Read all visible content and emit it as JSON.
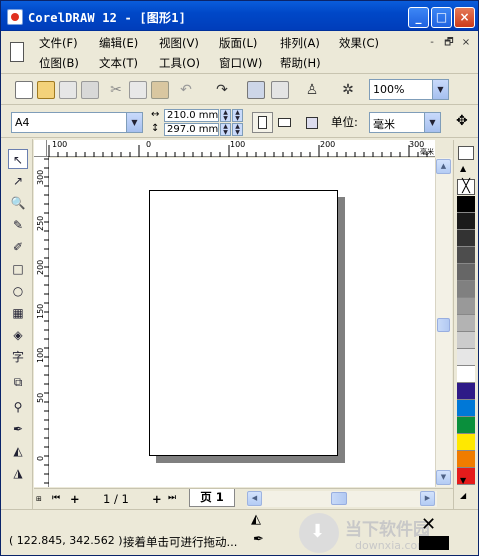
{
  "window": {
    "title": "CorelDRAW 12 - [图形1]",
    "min": "_",
    "max": "□",
    "close": "×"
  },
  "menu": {
    "row1": [
      "文件(F)",
      "编辑(E)",
      "视图(V)",
      "版面(L)",
      "排列(A)",
      "效果(C)"
    ],
    "row2": [
      "位图(B)",
      "文本(T)",
      "工具(O)",
      "窗口(W)",
      "帮助(H)"
    ],
    "mdi": [
      "-",
      "🗗",
      "×"
    ]
  },
  "standard_toolbar": {
    "icons": [
      "new-icon",
      "open-icon",
      "save-icon",
      "print-icon",
      "cut-icon",
      "copy-icon",
      "paste-icon",
      "undo-icon",
      "redo-icon",
      "import-icon",
      "export-icon",
      "app-launcher-icon",
      "corel-online-icon"
    ],
    "zoom_value": "100%"
  },
  "property_bar": {
    "page_size": "A4",
    "width": "210.0 mm",
    "height": "297.0 mm",
    "units_label": "单位:",
    "units_value": "毫米"
  },
  "toolbox": [
    "pick-tool",
    "shape-tool",
    "zoom-tool",
    "freehand-tool",
    "smart-drawing-tool",
    "rectangle-tool",
    "ellipse-tool",
    "polygon-tool",
    "basic-shapes-tool",
    "text-tool",
    "interactive-blend-tool",
    "eyedropper-tool",
    "outline-tool",
    "fill-tool",
    "interactive-fill-tool"
  ],
  "ruler": {
    "horizontal_labels": [
      "100",
      "0",
      "100",
      "200",
      "300"
    ],
    "vertical_labels": [
      "300",
      "250",
      "200",
      "150",
      "100",
      "50",
      "0"
    ],
    "unit_label": "毫米"
  },
  "palette": {
    "colors": [
      "#000000",
      "#1a1a1a",
      "#333333",
      "#4d4d4d",
      "#666666",
      "#808080",
      "#999999",
      "#b3b3b3",
      "#cccccc",
      "#e6e6e6",
      "#ffffff",
      "#2e1a87",
      "#0078d7",
      "#0a8f3c",
      "#ffe800",
      "#f07c00",
      "#e51b1b"
    ]
  },
  "page_nav": {
    "count": "1 / 1",
    "tab": "页 1"
  },
  "status": {
    "coords": "( 122.845, 342.562 )",
    "hint": "接着单击可进行拖动...",
    "watermark_main": "当下软件园",
    "watermark_sub": "downxia.com"
  }
}
